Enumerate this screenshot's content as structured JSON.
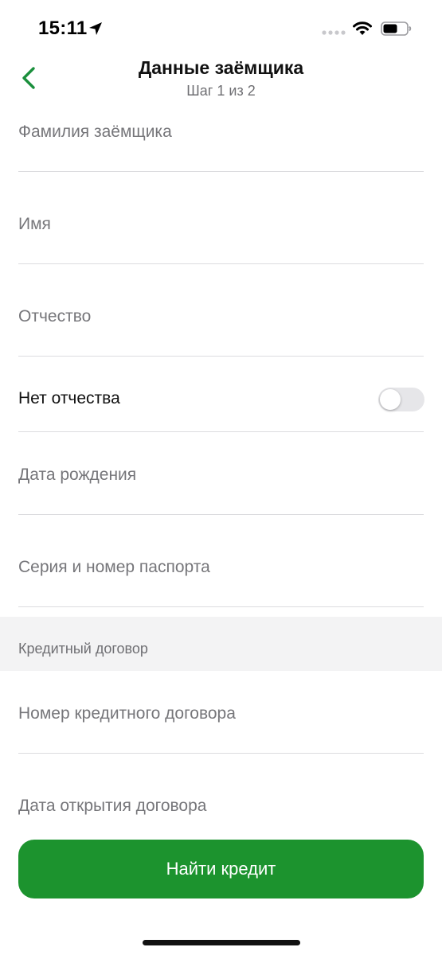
{
  "status_bar": {
    "time": "15:11",
    "icons": [
      "location-arrow-icon",
      "signal-dots-icon",
      "wifi-icon",
      "battery-icon"
    ]
  },
  "header": {
    "title": "Данные заёмщика",
    "subtitle": "Шаг 1 из 2",
    "back_icon": "chevron-left-icon"
  },
  "fields": {
    "surname": "Фамилия заёмщика",
    "name": "Имя",
    "patronymic": "Отчество",
    "no_patronymic": {
      "label": "Нет отчества",
      "enabled": false
    },
    "birth_date": "Дата рождения",
    "passport": "Серия и номер паспорта"
  },
  "section": {
    "title": "Кредитный договор"
  },
  "contract_fields": {
    "number": "Номер кредитного договора",
    "open_date": "Дата открытия договора"
  },
  "submit": {
    "label": "Найти кредит"
  },
  "colors": {
    "accent": "#1c932e",
    "back_icon": "#1a8f3c",
    "divider": "#dcdcdf",
    "section_bg": "#f3f3f4",
    "toggle_off": "#e6e6e9"
  }
}
